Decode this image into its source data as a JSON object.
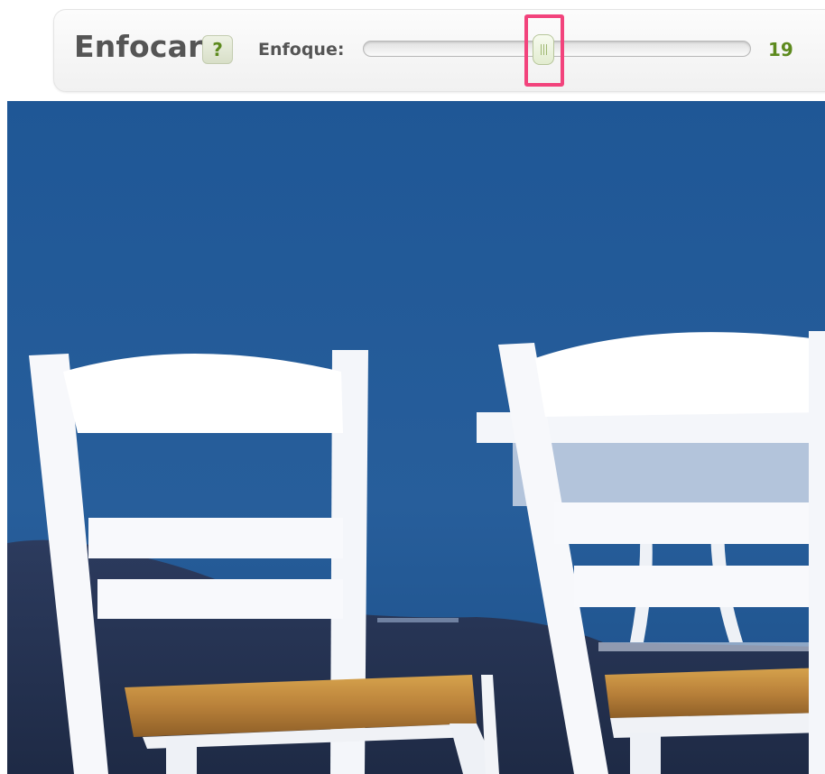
{
  "tool": {
    "title": "Enfocar",
    "help_label": "?"
  },
  "slider": {
    "label": "Enfoque:",
    "value": "19",
    "fraction": 0.44,
    "accent_color": "#5d8a1e",
    "highlight_color": "#f2437c"
  },
  "image": {
    "icons": {
      "help": "question-mark-icon",
      "thumb": "slider-grip-icon"
    }
  }
}
